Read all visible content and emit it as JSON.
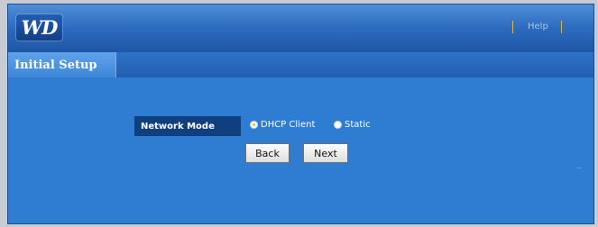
{
  "header": {
    "logo_text": "WD",
    "help_label": "Help",
    "separator_color": "#e2b34a"
  },
  "tabs": [
    {
      "label": "Initial Setup",
      "active": true
    }
  ],
  "form": {
    "network_mode_label": "Network Mode",
    "options": [
      {
        "label": "DHCP Client",
        "selected": true
      },
      {
        "label": "Static",
        "selected": false
      }
    ]
  },
  "buttons": {
    "back_label": "Back",
    "next_label": "Next"
  },
  "colors": {
    "background": "#2f7dd2",
    "label_background": "#103f80",
    "radio_selected": "#f4c31c"
  },
  "icons": {
    "logo": "wd-logo-icon",
    "radio_selected": "radio-selected-icon",
    "radio_unselected": "radio-unselected-icon"
  }
}
